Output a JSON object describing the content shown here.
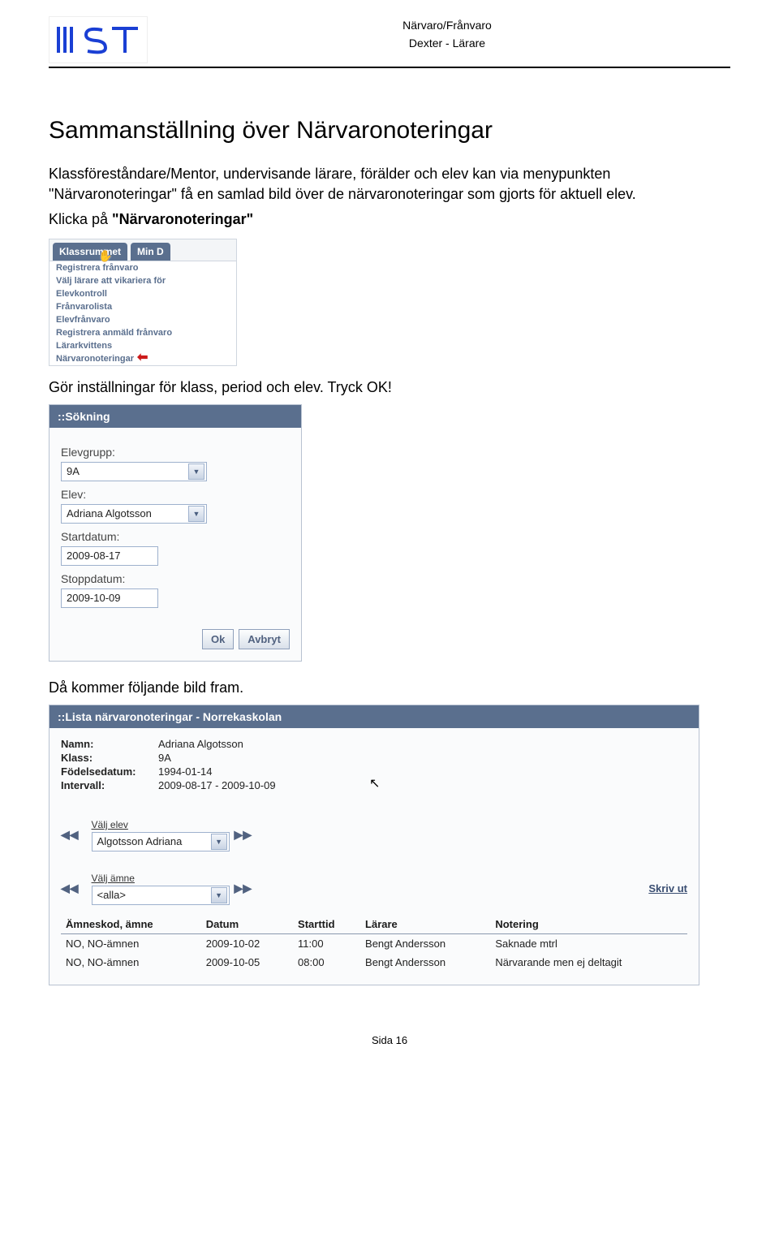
{
  "header": {
    "line1": "Närvaro/Frånvaro",
    "line2": "Dexter - Lärare"
  },
  "section_title": "Sammanställning över Närvaronoteringar",
  "intro_text": "Klassföreståndare/Mentor, undervisande lärare, förälder och elev kan via menypunkten \"Närvaronoteringar\" få en samlad bild över de närvaronoteringar som gjorts för aktuell elev.",
  "click_instruction_prefix": "Klicka på ",
  "click_instruction_bold": "\"Närvaronoteringar\"",
  "dropdown": {
    "tab1": "Klassrummet",
    "tab2": "Min D",
    "items": [
      "Registrera frånvaro",
      "Välj lärare att vikariera för",
      "Elevkontroll",
      "Frånvarolista",
      "Elevfrånvaro",
      "Registrera anmäld frånvaro",
      "Lärarkvittens",
      "Närvaronoteringar"
    ]
  },
  "settings_instruction": "Gör inställningar för klass, period och elev. Tryck OK!",
  "search": {
    "title": "::Sökning",
    "group_label": "Elevgrupp:",
    "group_value": "9A",
    "student_label": "Elev:",
    "student_value": "Adriana Algotsson",
    "start_label": "Startdatum:",
    "start_value": "2009-08-17",
    "stop_label": "Stoppdatum:",
    "stop_value": "2009-10-09",
    "ok": "Ok",
    "cancel": "Avbryt"
  },
  "result_intro": "Då kommer följande bild fram.",
  "list": {
    "title": "::Lista närvaronoteringar - Norrekaskolan",
    "name_k": "Namn:",
    "name_v": "Adriana Algotsson",
    "class_k": "Klass:",
    "class_v": "9A",
    "birth_k": "Födelsedatum:",
    "birth_v": "1994-01-14",
    "interval_k": "Intervall:",
    "interval_v": "2009-08-17 - 2009-10-09",
    "sel_student_label": "Välj elev",
    "sel_student_value": "Algotsson Adriana",
    "sel_subject_label": "Välj ämne",
    "sel_subject_value": "<alla>",
    "print": "Skriv ut",
    "columns": {
      "subject": "Ämneskod, ämne",
      "date": "Datum",
      "time": "Starttid",
      "teacher": "Lärare",
      "note": "Notering"
    },
    "rows": [
      {
        "subject": "NO, NO-ämnen",
        "date": "2009-10-02",
        "time": "11:00",
        "teacher": "Bengt Andersson",
        "note": "Saknade mtrl"
      },
      {
        "subject": "NO, NO-ämnen",
        "date": "2009-10-05",
        "time": "08:00",
        "teacher": "Bengt Andersson",
        "note": "Närvarande men ej deltagit"
      }
    ]
  },
  "footer": "Sida 16"
}
